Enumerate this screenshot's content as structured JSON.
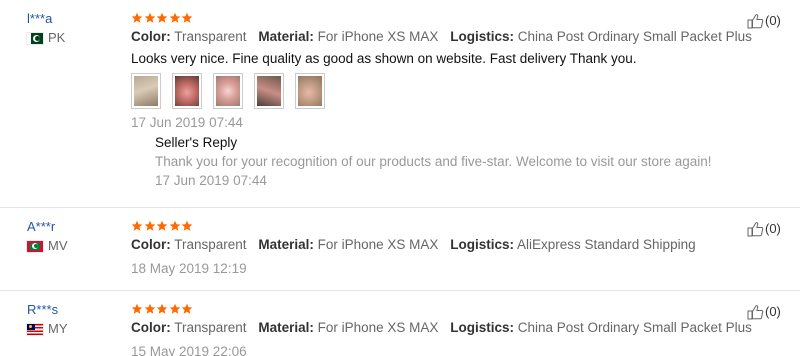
{
  "reviews": [
    {
      "user": "l***a",
      "country": "PK",
      "stars": 5,
      "attrs": [
        {
          "label": "Color:",
          "value": "Transparent"
        },
        {
          "label": "Material:",
          "value": "For iPhone XS MAX"
        },
        {
          "label": "Logistics:",
          "value": "China Post Ordinary Small Packet Plus"
        }
      ],
      "text": "Looks very nice. Fine quality as good as shown on website. Fast delivery Thank you.",
      "photo_count": 5,
      "date": "17 Jun 2019 07:44",
      "reply": {
        "title": "Seller's Reply",
        "text": "Thank you for your recognition of our products and five-star. Welcome to visit our store again!",
        "date": "17 Jun 2019 07:44"
      },
      "helpful": "(0)"
    },
    {
      "user": "A***r",
      "country": "MV",
      "stars": 5,
      "attrs": [
        {
          "label": "Color:",
          "value": "Transparent"
        },
        {
          "label": "Material:",
          "value": "For iPhone XS MAX"
        },
        {
          "label": "Logistics:",
          "value": "AliExpress Standard Shipping"
        }
      ],
      "date": "18 May 2019 12:19",
      "helpful": "(0)"
    },
    {
      "user": "R***s",
      "country": "MY",
      "stars": 5,
      "attrs": [
        {
          "label": "Color:",
          "value": "Transparent"
        },
        {
          "label": "Material:",
          "value": "For iPhone XS MAX"
        },
        {
          "label": "Logistics:",
          "value": "China Post Ordinary Small Packet Plus"
        }
      ],
      "date": "15 May 2019 22:06",
      "helpful": "(0)"
    }
  ],
  "colors": {
    "star": "#ff6a00",
    "username": "#2255aa",
    "muted": "#999999",
    "divider": "#e6e6e6"
  },
  "icons": {
    "rating": "star-icon",
    "helpful": "thumbs-up-icon"
  }
}
